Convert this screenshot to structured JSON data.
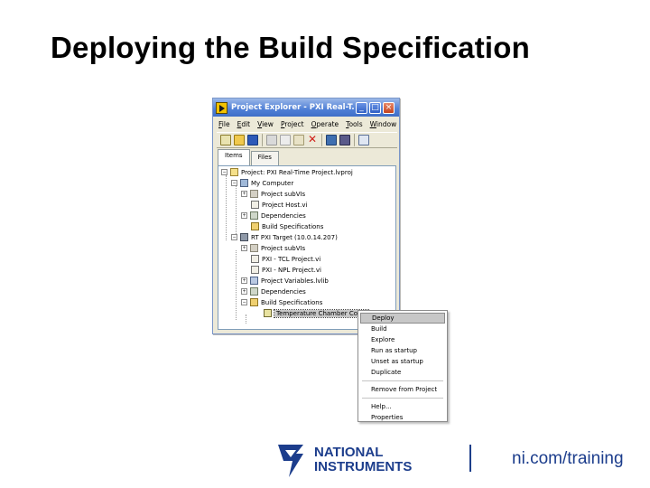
{
  "slide": {
    "title": "Deploying the Build Specification"
  },
  "window": {
    "title": "Project Explorer - PXI Real-T...",
    "controls": {
      "minimize": "_",
      "maximize": "□",
      "close": "×"
    },
    "menu": [
      "File",
      "Edit",
      "View",
      "Project",
      "Operate",
      "Tools",
      "Window"
    ],
    "tabs": [
      "Items",
      "Files"
    ],
    "tree": [
      {
        "label": "Project: PXI Real-Time Project.lvproj",
        "icon": "project-icon"
      },
      {
        "label": "My Computer",
        "icon": "computer-icon"
      },
      {
        "label": "Project subVIs",
        "icon": "folder-icon"
      },
      {
        "label": "Project Host.vi",
        "icon": "vi-icon"
      },
      {
        "label": "Dependencies",
        "icon": "dependencies-icon"
      },
      {
        "label": "Build Specifications",
        "icon": "build-spec-icon"
      },
      {
        "label": "RT PXI Target (10.0.14.207)",
        "icon": "pxi-target-icon"
      },
      {
        "label": "Project subVIs",
        "icon": "folder-icon"
      },
      {
        "label": "PXI - TCL Project.vi",
        "icon": "vi-icon"
      },
      {
        "label": "PXI - NPL Project.vi",
        "icon": "vi-icon"
      },
      {
        "label": "Project Variables.lvlib",
        "icon": "library-icon"
      },
      {
        "label": "Dependencies",
        "icon": "dependencies-icon"
      },
      {
        "label": "Build Specifications",
        "icon": "build-spec-icon"
      },
      {
        "label": "Temperature Chamber Contr",
        "icon": "rt-app-icon"
      }
    ]
  },
  "context_menu": {
    "items": [
      "Deploy",
      "Build",
      "Explore",
      "Run as startup",
      "Unset as startup",
      "Duplicate",
      "Remove from Project",
      "Help...",
      "Properties"
    ],
    "highlighted": "Deploy"
  },
  "footer": {
    "logo_text_1": "NATIONAL",
    "logo_text_2": "INSTRUMENTS",
    "url": "ni.com/training"
  },
  "colors": {
    "accent_blue": "#1c3d8c",
    "title_bar": "#3e6ec8"
  }
}
